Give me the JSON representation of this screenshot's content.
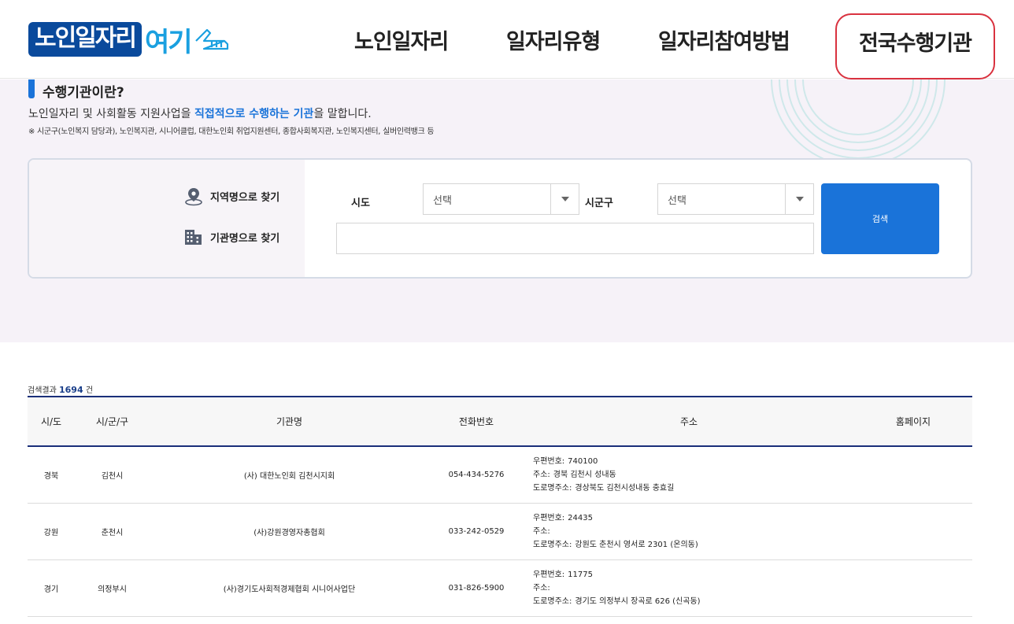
{
  "header": {
    "logo_main": "노인일자리",
    "logo_sub": "여기",
    "nav": [
      "노인일자리",
      "일자리유형",
      "일자리참여방법"
    ],
    "nav_active": "전국수행기관"
  },
  "intro": {
    "title": "수행기관이란?",
    "desc_before": "노인일자리 및 사회활동 지원사업을 ",
    "desc_highlight": "직접적으로 수행하는 기관",
    "desc_after": "을 말합니다.",
    "note": "※ 시군구(노인복지 담당과), 노인복지관, 시니어클럽, 대한노인회 취업지원센터, 종합사회복지관, 노인복지센터, 실버인력뱅크 등"
  },
  "search": {
    "option_region": "지역명으로 찾기",
    "option_org": "기관명으로 찾기",
    "sido_label": "시도",
    "sido_value": "선택",
    "sigungu_label": "시군구",
    "sigungu_value": "선택",
    "org_input_value": "",
    "button_label": "검색"
  },
  "results": {
    "count_prefix": "검색결과",
    "count": "1694",
    "count_suffix": "건",
    "columns": [
      "시/도",
      "시/군/구",
      "기관명",
      "전화번호",
      "주소",
      "홈페이지"
    ],
    "postal_label": "우편번호:",
    "address_label": "주소:",
    "road_label": "도로명주소:",
    "rows": [
      {
        "sido": "경북",
        "sigungu": "김천시",
        "name": "(사) 대한노인회 김천시지회",
        "phone": "054-434-5276",
        "postal": "740100",
        "address": "경북 김천시 성내동",
        "road": "경상북도 김천시성내동 충효길",
        "homepage": ""
      },
      {
        "sido": "강원",
        "sigungu": "춘천시",
        "name": "(사)강원경영자총협회",
        "phone": "033-242-0529",
        "postal": "24435",
        "address": "",
        "road": "강원도 춘천시 영서로 2301 (온의동)",
        "homepage": ""
      },
      {
        "sido": "경기",
        "sigungu": "의정부시",
        "name": "(사)경기도사회적경제협회 시니어사업단",
        "phone": "031-826-5900",
        "postal": "11775",
        "address": "",
        "road": "경기도 의정부시 장곡로 626 (신곡동)",
        "homepage": ""
      }
    ]
  },
  "colors": {
    "brand_navy": "#0a4a9c",
    "brand_sky": "#1aa0e0",
    "accent_blue": "#1a73d9",
    "active_outline": "#d9323f",
    "table_rule": "#1a2f7a"
  }
}
